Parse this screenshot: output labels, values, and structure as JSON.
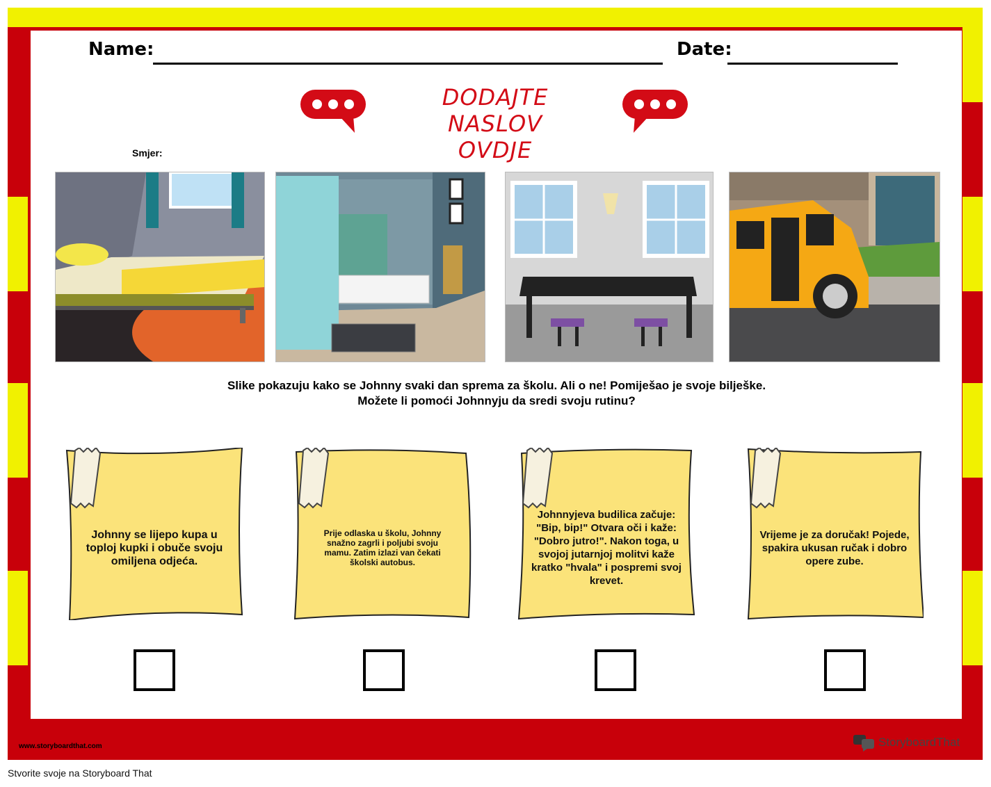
{
  "header": {
    "name_label": "Name:",
    "date_label": "Date:"
  },
  "title": {
    "line1": "DODAJTE NASLOV",
    "line2": "OVDJE"
  },
  "directions_label": "Smjer:",
  "scenes": [
    {
      "name": "bedroom"
    },
    {
      "name": "bathroom"
    },
    {
      "name": "dining-room"
    },
    {
      "name": "school-bus"
    }
  ],
  "instructions": {
    "line1": "Slike pokazuju kako se Johnny svaki dan sprema za školu. Ali o ne! Pomiješao je svoje bilješke.",
    "line2": "Možete li pomoći Johnnyju da sredi svoju rutinu?"
  },
  "notes": [
    {
      "text": "Johnny se lijepo kupa u toploj kupki i obuče svoju omiljena odjeća."
    },
    {
      "text": "Prije odlaska u školu, Johnny snažno zagrli i poljubi svoju mamu. Zatim izlazi van čekati školski autobus."
    },
    {
      "text": "Johnnyjeva budilica začuje: \"Bip, bip!\" Otvara oči i kaže: \"Dobro jutro!\". Nakon toga, u svojoj jutarnjoj molitvi kaže kratko \"hvala\" i pospremi svoj krevet."
    },
    {
      "text": "Vrijeme je za doručak! Pojede, spakira ukusan ručak i dobro opere zube."
    }
  ],
  "footer": {
    "site": "www.storyboardthat.com",
    "brand": "StoryboardThat",
    "caption": "Stvorite svoje na Storyboard That"
  },
  "colors": {
    "border_red": "#c8000a",
    "border_yellow": "#f1f100",
    "title_red": "#d30b16",
    "note_yellow": "#fbe37a"
  }
}
